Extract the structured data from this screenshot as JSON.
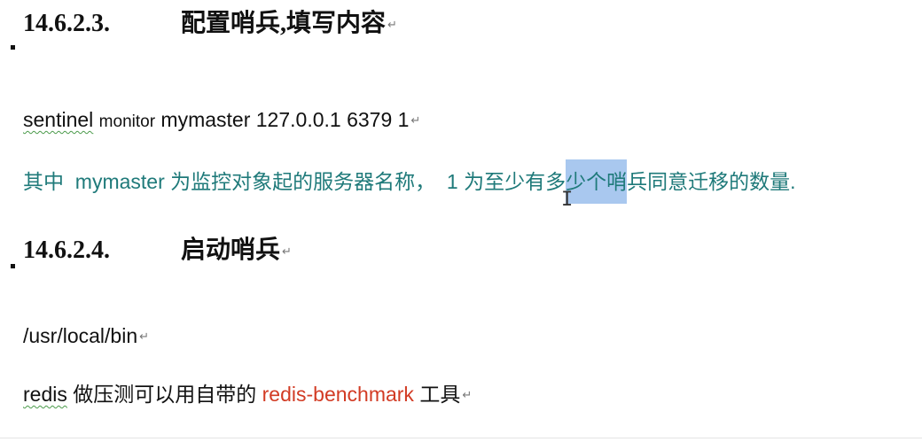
{
  "headings": [
    {
      "number": "14.6.2.3.",
      "title": "配置哨兵,填写内容"
    },
    {
      "number": "14.6.2.4.",
      "title": "启动哨兵"
    }
  ],
  "config_line": {
    "kw1": "sentinel",
    "kw2": "monitor",
    "rest": "mymaster 127.0.0.1 6379 1"
  },
  "explanation": {
    "p1": "其中",
    "p2": "mymaster",
    "p3": "为监控对象起的服务器名称，",
    "p4": "1",
    "p5": "为至少有多",
    "selected": "少个哨",
    "p6": "兵同意迁移的数量."
  },
  "path_line": "/usr/local/bin",
  "redis_line": {
    "p1": "redis",
    "p2": "做压测可以用自带的",
    "tool": "redis-benchmark",
    "p3": "工具"
  },
  "return_mark": "↵",
  "colors": {
    "teal": "#1f7a7a",
    "red": "#d23b24",
    "selection": "#a9c8ef"
  }
}
